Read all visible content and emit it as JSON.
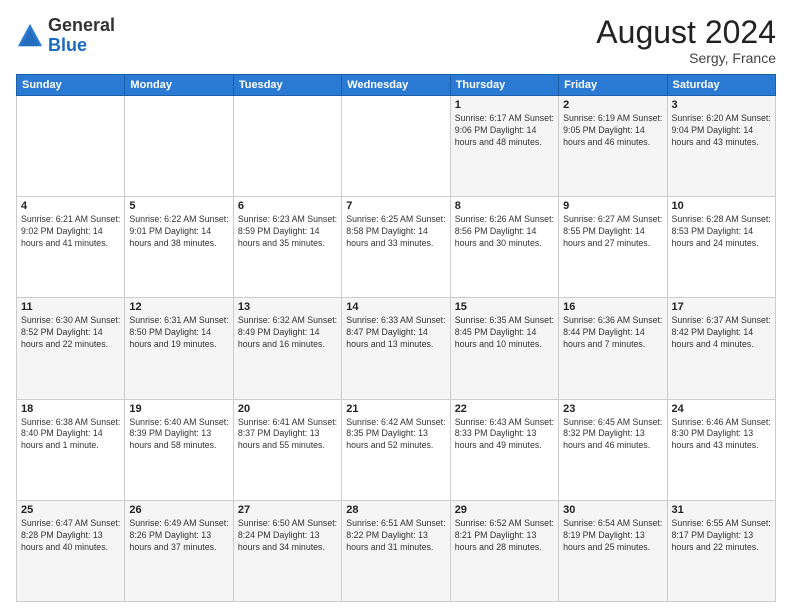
{
  "header": {
    "logo": {
      "general": "General",
      "blue": "Blue"
    },
    "title": "August 2024",
    "location": "Sergy, France"
  },
  "calendar": {
    "weekdays": [
      "Sunday",
      "Monday",
      "Tuesday",
      "Wednesday",
      "Thursday",
      "Friday",
      "Saturday"
    ],
    "weeks": [
      [
        {
          "day": "",
          "info": ""
        },
        {
          "day": "",
          "info": ""
        },
        {
          "day": "",
          "info": ""
        },
        {
          "day": "",
          "info": ""
        },
        {
          "day": "1",
          "info": "Sunrise: 6:17 AM\nSunset: 9:06 PM\nDaylight: 14 hours\nand 48 minutes."
        },
        {
          "day": "2",
          "info": "Sunrise: 6:19 AM\nSunset: 9:05 PM\nDaylight: 14 hours\nand 46 minutes."
        },
        {
          "day": "3",
          "info": "Sunrise: 6:20 AM\nSunset: 9:04 PM\nDaylight: 14 hours\nand 43 minutes."
        }
      ],
      [
        {
          "day": "4",
          "info": "Sunrise: 6:21 AM\nSunset: 9:02 PM\nDaylight: 14 hours\nand 41 minutes."
        },
        {
          "day": "5",
          "info": "Sunrise: 6:22 AM\nSunset: 9:01 PM\nDaylight: 14 hours\nand 38 minutes."
        },
        {
          "day": "6",
          "info": "Sunrise: 6:23 AM\nSunset: 8:59 PM\nDaylight: 14 hours\nand 35 minutes."
        },
        {
          "day": "7",
          "info": "Sunrise: 6:25 AM\nSunset: 8:58 PM\nDaylight: 14 hours\nand 33 minutes."
        },
        {
          "day": "8",
          "info": "Sunrise: 6:26 AM\nSunset: 8:56 PM\nDaylight: 14 hours\nand 30 minutes."
        },
        {
          "day": "9",
          "info": "Sunrise: 6:27 AM\nSunset: 8:55 PM\nDaylight: 14 hours\nand 27 minutes."
        },
        {
          "day": "10",
          "info": "Sunrise: 6:28 AM\nSunset: 8:53 PM\nDaylight: 14 hours\nand 24 minutes."
        }
      ],
      [
        {
          "day": "11",
          "info": "Sunrise: 6:30 AM\nSunset: 8:52 PM\nDaylight: 14 hours\nand 22 minutes."
        },
        {
          "day": "12",
          "info": "Sunrise: 6:31 AM\nSunset: 8:50 PM\nDaylight: 14 hours\nand 19 minutes."
        },
        {
          "day": "13",
          "info": "Sunrise: 6:32 AM\nSunset: 8:49 PM\nDaylight: 14 hours\nand 16 minutes."
        },
        {
          "day": "14",
          "info": "Sunrise: 6:33 AM\nSunset: 8:47 PM\nDaylight: 14 hours\nand 13 minutes."
        },
        {
          "day": "15",
          "info": "Sunrise: 6:35 AM\nSunset: 8:45 PM\nDaylight: 14 hours\nand 10 minutes."
        },
        {
          "day": "16",
          "info": "Sunrise: 6:36 AM\nSunset: 8:44 PM\nDaylight: 14 hours\nand 7 minutes."
        },
        {
          "day": "17",
          "info": "Sunrise: 6:37 AM\nSunset: 8:42 PM\nDaylight: 14 hours\nand 4 minutes."
        }
      ],
      [
        {
          "day": "18",
          "info": "Sunrise: 6:38 AM\nSunset: 8:40 PM\nDaylight: 14 hours\nand 1 minute."
        },
        {
          "day": "19",
          "info": "Sunrise: 6:40 AM\nSunset: 8:39 PM\nDaylight: 13 hours\nand 58 minutes."
        },
        {
          "day": "20",
          "info": "Sunrise: 6:41 AM\nSunset: 8:37 PM\nDaylight: 13 hours\nand 55 minutes."
        },
        {
          "day": "21",
          "info": "Sunrise: 6:42 AM\nSunset: 8:35 PM\nDaylight: 13 hours\nand 52 minutes."
        },
        {
          "day": "22",
          "info": "Sunrise: 6:43 AM\nSunset: 8:33 PM\nDaylight: 13 hours\nand 49 minutes."
        },
        {
          "day": "23",
          "info": "Sunrise: 6:45 AM\nSunset: 8:32 PM\nDaylight: 13 hours\nand 46 minutes."
        },
        {
          "day": "24",
          "info": "Sunrise: 6:46 AM\nSunset: 8:30 PM\nDaylight: 13 hours\nand 43 minutes."
        }
      ],
      [
        {
          "day": "25",
          "info": "Sunrise: 6:47 AM\nSunset: 8:28 PM\nDaylight: 13 hours\nand 40 minutes."
        },
        {
          "day": "26",
          "info": "Sunrise: 6:49 AM\nSunset: 8:26 PM\nDaylight: 13 hours\nand 37 minutes."
        },
        {
          "day": "27",
          "info": "Sunrise: 6:50 AM\nSunset: 8:24 PM\nDaylight: 13 hours\nand 34 minutes."
        },
        {
          "day": "28",
          "info": "Sunrise: 6:51 AM\nSunset: 8:22 PM\nDaylight: 13 hours\nand 31 minutes."
        },
        {
          "day": "29",
          "info": "Sunrise: 6:52 AM\nSunset: 8:21 PM\nDaylight: 13 hours\nand 28 minutes."
        },
        {
          "day": "30",
          "info": "Sunrise: 6:54 AM\nSunset: 8:19 PM\nDaylight: 13 hours\nand 25 minutes."
        },
        {
          "day": "31",
          "info": "Sunrise: 6:55 AM\nSunset: 8:17 PM\nDaylight: 13 hours\nand 22 minutes."
        }
      ]
    ]
  }
}
